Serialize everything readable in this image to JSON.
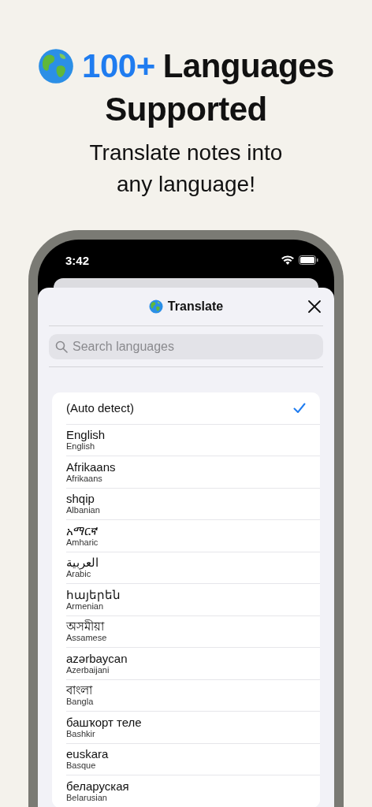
{
  "headline": {
    "accent": "100+",
    "line1": "Languages",
    "line2": "Supported"
  },
  "subtitle": "Translate notes into any language!",
  "status_bar": {
    "time": "3:42"
  },
  "sheet": {
    "title": "Translate"
  },
  "search": {
    "placeholder": "Search languages"
  },
  "languages": [
    {
      "name": "(Auto detect)",
      "selected": true
    },
    {
      "name": "English",
      "english": "English",
      "selected": false
    },
    {
      "name": "Afrikaans",
      "english": "Afrikaans",
      "selected": false
    },
    {
      "name": "shqip",
      "english": "Albanian",
      "selected": false
    },
    {
      "name": "አማርኛ",
      "english": "Amharic",
      "selected": false
    },
    {
      "name": "العربية",
      "english": "Arabic",
      "selected": false
    },
    {
      "name": "հայերեն",
      "english": "Armenian",
      "selected": false
    },
    {
      "name": "অসমীয়া",
      "english": "Assamese",
      "selected": false
    },
    {
      "name": "azərbaycan",
      "english": "Azerbaijani",
      "selected": false
    },
    {
      "name": "বাংলা",
      "english": "Bangla",
      "selected": false
    },
    {
      "name": "башҡорт теле",
      "english": "Bashkir",
      "selected": false
    },
    {
      "name": "euskara",
      "english": "Basque",
      "selected": false
    },
    {
      "name": "беларуская",
      "english": "Belarusian",
      "selected": false
    }
  ]
}
